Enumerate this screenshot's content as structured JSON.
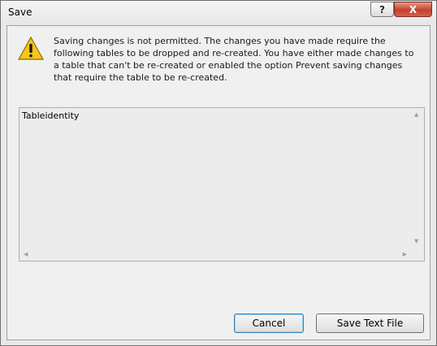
{
  "window": {
    "title": "Save",
    "help_glyph": "?",
    "close_glyph": "X"
  },
  "dialog": {
    "icon": "warning-icon",
    "message": "Saving changes is not permitted. The changes you have made require the following tables to be dropped and re-created. You have either made changes to a table that can't be re-created or enabled the option Prevent saving changes that require the table to be re-created."
  },
  "list": {
    "items": [
      "Tableidentity"
    ]
  },
  "buttons": {
    "cancel_label": "Cancel",
    "save_text_label": "Save Text File"
  },
  "colors": {
    "close_button": "#c4402c",
    "focus_border": "#3c7fb1",
    "warning_fill": "#f5c518"
  }
}
